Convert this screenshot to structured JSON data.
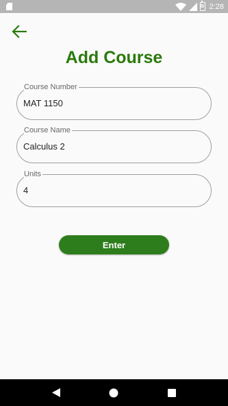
{
  "status_bar": {
    "time": "2:28",
    "icons": [
      "sd-card-icon",
      "wifi-icon",
      "signal-icon",
      "battery-icon"
    ],
    "battery_glyph": "B"
  },
  "header": {
    "back_icon": "arrow-left-icon",
    "title": "Add Course"
  },
  "form": {
    "fields": [
      {
        "label": "Course Number",
        "value": "MAT 1150"
      },
      {
        "label": "Course Name",
        "value": "Calculus 2"
      },
      {
        "label": "Units",
        "value": "4"
      }
    ],
    "submit_label": "Enter"
  },
  "nav_bar": {
    "icons": [
      "back-triangle-icon",
      "home-circle-icon",
      "recents-square-icon"
    ]
  },
  "colors": {
    "accent": "#2b7a0b",
    "button": "#2e7d1c",
    "status_bar": "#b5b5b5",
    "nav_bar": "#000000"
  }
}
